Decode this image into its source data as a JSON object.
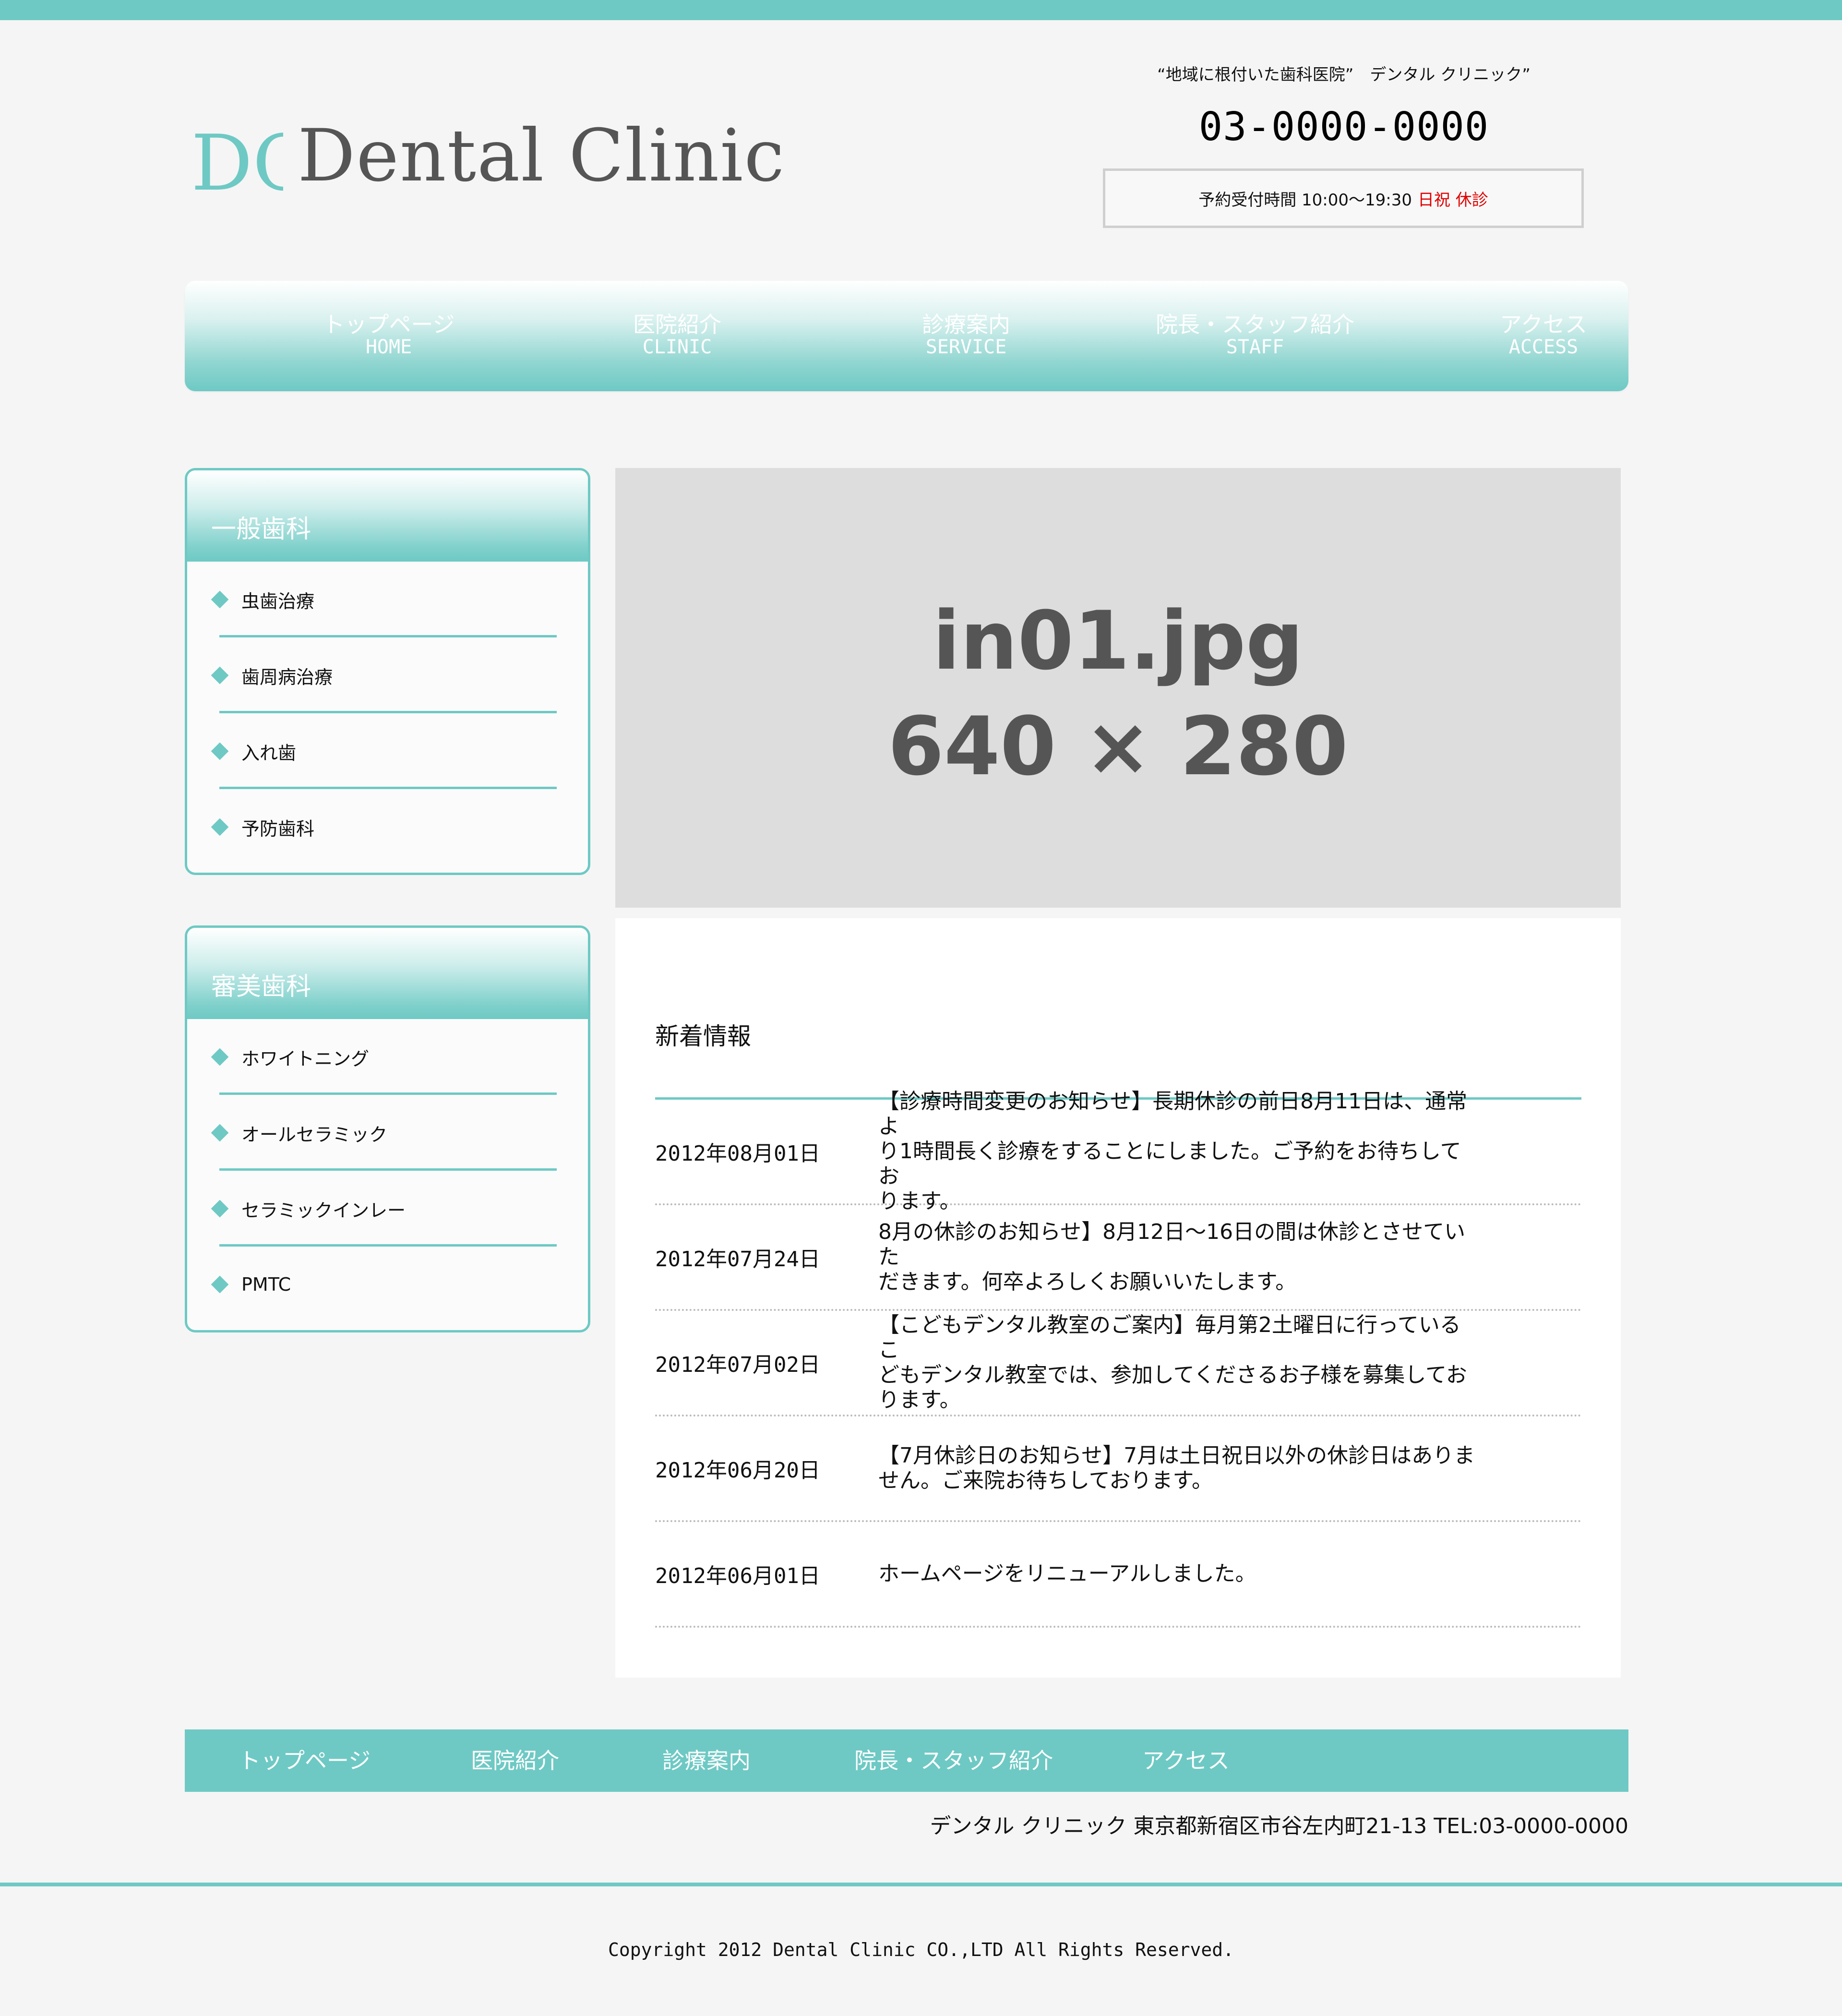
{
  "header": {
    "logo_mark": "DC",
    "logo_text": "Dental Clinic",
    "tagline": "“地域に根付いた歯科医院”　デンタル クリニック”",
    "phone": "03-0000-0000",
    "hours_label": "予約受付時間 10:00〜19:30",
    "hours_closed": "日祝 休診"
  },
  "global_nav": {
    "items": [
      {
        "jp": "トップページ",
        "en": "HOME"
      },
      {
        "jp": "医院紹介",
        "en": "CLINIC"
      },
      {
        "jp": "診療案内",
        "en": "SERVICE"
      },
      {
        "jp": "院長・スタッフ紹介",
        "en": "STAFF"
      },
      {
        "jp": "アクセス",
        "en": "ACCESS"
      }
    ]
  },
  "sidebar": {
    "general": {
      "title": "一般歯科",
      "items": [
        "虫歯治療",
        "歯周病治療",
        "入れ歯",
        "予防歯科"
      ]
    },
    "cosmetic": {
      "title": "審美歯科",
      "items": [
        "ホワイトニング",
        "オールセラミック",
        "セラミックインレー",
        "PMTC"
      ]
    }
  },
  "main_image": {
    "filename": "in01.jpg",
    "size": "640 × 280"
  },
  "news": {
    "title": "新着情報",
    "items": [
      {
        "date": "2012年08月01日",
        "lines": [
          "【診療時間変更のお知らせ】長期休診の前日8月11日は、通常よ",
          "り1時間長く診療をすることにしました。ご予約をお待ちしてお",
          "ります。"
        ]
      },
      {
        "date": "2012年07月24日",
        "lines": [
          "8月の休診のお知らせ】8月12日〜16日の間は休診とさせていた",
          "だきます。何卒よろしくお願いいたします。"
        ]
      },
      {
        "date": "2012年07月02日",
        "lines": [
          "【こどもデンタル教室のご案内】毎月第2土曜日に行っているこ",
          "どもデンタル教室では、参加してくださるお子様を募集してお",
          "ります。"
        ]
      },
      {
        "date": "2012年06月20日",
        "lines": [
          "【7月休診日のお知らせ】7月は土日祝日以外の休診日はありま",
          "せん。ご来院お待ちしております。"
        ]
      },
      {
        "date": "2012年06月01日",
        "lines": [
          "ホームページをリニューアルしました。"
        ]
      }
    ]
  },
  "footer": {
    "links": [
      "トップページ",
      "医院紹介",
      "診療案内",
      "院長・スタッフ紹介",
      "アクセス"
    ],
    "address": "デンタル クリニック 東京都新宿区市谷左内町21-13 TEL:03-0000-0000",
    "copyright": "Copyright 2012 Dental Clinic CO.,LTD All Rights Reserved."
  },
  "colors": {
    "accent": "#6ec9c4",
    "background": "#f5f5f5",
    "closed_text": "#e00000",
    "placeholder_gray": "#dddddd"
  }
}
